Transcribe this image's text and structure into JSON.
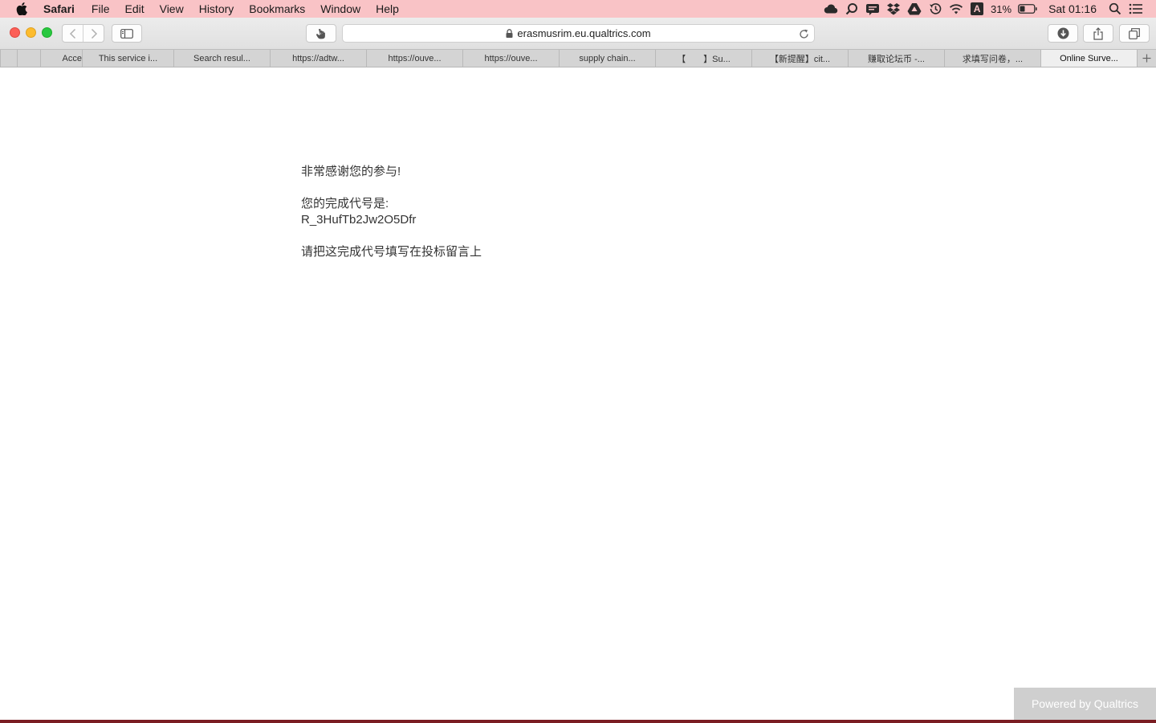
{
  "menubar": {
    "app_name": "Safari",
    "items": [
      "File",
      "Edit",
      "View",
      "History",
      "Bookmarks",
      "Window",
      "Help"
    ],
    "status": {
      "input_source": "A",
      "battery_percent": "31%",
      "clock": "Sat 01:16"
    }
  },
  "toolbar": {
    "url": "erasmusrim.eu.qualtrics.com"
  },
  "tabs": [
    {
      "label": "Acce"
    },
    {
      "label": "This service i..."
    },
    {
      "label": "Search resul..."
    },
    {
      "label": "https://adtw..."
    },
    {
      "label": "https://ouve..."
    },
    {
      "label": "https://ouve..."
    },
    {
      "label": "supply chain..."
    },
    {
      "label": "【　　】Su..."
    },
    {
      "label": "【新提醒】cit..."
    },
    {
      "label": "赚取论坛币 -..."
    },
    {
      "label": "求填写问卷，..."
    },
    {
      "label": "Online Surve..."
    }
  ],
  "page": {
    "thanks": "非常感谢您的参与!",
    "code_label": "您的完成代号是:",
    "code_value": "R_3HufTb2Jw2O5Dfr",
    "instruction": "请把这完成代号填写在投标留言上",
    "powered_by": "Powered by Qualtrics"
  }
}
